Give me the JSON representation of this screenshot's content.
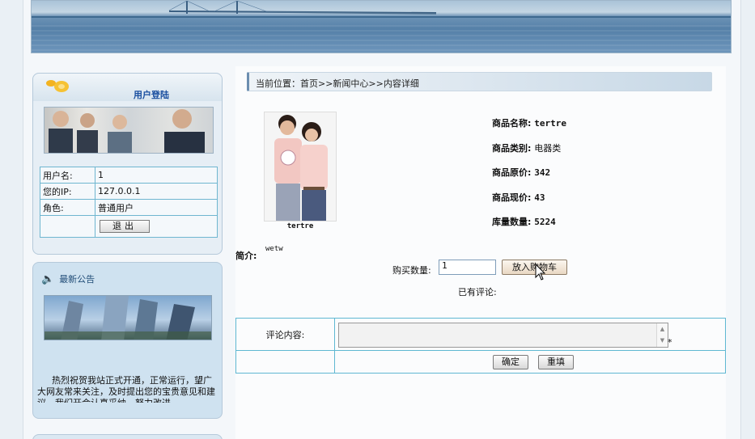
{
  "login": {
    "title": "用户登陆",
    "rows": [
      {
        "label": "用户名:",
        "value": "1"
      },
      {
        "label": "您的IP:",
        "value": "127.0.0.1"
      },
      {
        "label": "角色:",
        "value": "普通用户"
      }
    ],
    "logout_label": "退出"
  },
  "notice": {
    "title": "最新公告",
    "text": "热烈祝贺我站正式开通，正常运行，望广大网友常来关注，及时提出您的宝贵意见和建议，我们开会认真采纳，努力改进"
  },
  "breadcrumb": "当前位置：首页>>新闻中心>>内容详细",
  "product": {
    "caption": "tertre",
    "specs": [
      {
        "label": "商品名称:",
        "value": "tertre",
        "cn": false
      },
      {
        "label": "商品类别:",
        "value": "电器类",
        "cn": true
      },
      {
        "label": "商品原价:",
        "value": "342",
        "cn": false
      },
      {
        "label": "商品现价:",
        "value": "43",
        "cn": false
      },
      {
        "label": "库量数量:",
        "value": "5224",
        "cn": false
      }
    ],
    "intro_label": "简介:",
    "intro_text": "wetw"
  },
  "purchase": {
    "qty_label": "购买数量:",
    "qty_value": "1",
    "cart_label": "放入购物车"
  },
  "comments": {
    "existing_label": "已有评论:",
    "content_label": "评论内容:",
    "required_mark": "*",
    "confirm_label": "确定",
    "reset_label": "重填"
  },
  "icons": {
    "speaker": "speaker-icon",
    "cursor": "mouse-cursor-icon"
  }
}
